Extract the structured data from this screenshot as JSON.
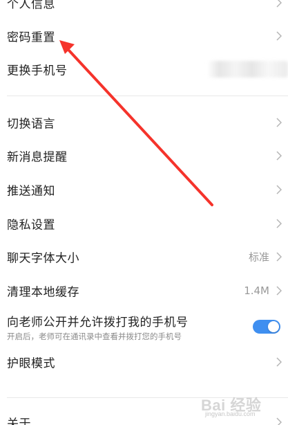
{
  "settings": {
    "items": [
      {
        "label": "个人信息",
        "value": ""
      },
      {
        "label": "密码重置",
        "value": ""
      },
      {
        "label": "更换手机号",
        "value": ""
      },
      {
        "label": "切换语言",
        "value": ""
      },
      {
        "label": "新消息提醒",
        "value": ""
      },
      {
        "label": "推送通知",
        "value": ""
      },
      {
        "label": "隐私设置",
        "value": ""
      },
      {
        "label": "聊天字体大小",
        "value": "标准"
      },
      {
        "label": "清理本地缓存",
        "value": "1.4M"
      },
      {
        "label": "护眼模式",
        "value": ""
      },
      {
        "label": "关于",
        "value": ""
      }
    ],
    "phone_toggle": {
      "title": "向老师公开并允许拨打我的手机号",
      "description": "开启后，老师可在通讯录中查看并拨打您的手机号",
      "enabled": true
    }
  },
  "annotation": {
    "arrow_color": "#f5332b"
  },
  "watermark": {
    "text": "Bai 经验",
    "subtext": "jingyan.baidu.com"
  },
  "colors": {
    "toggle_on": "#3f8ff0",
    "text_primary": "#222222",
    "text_secondary": "#999999",
    "divider": "#e8e8e8"
  }
}
